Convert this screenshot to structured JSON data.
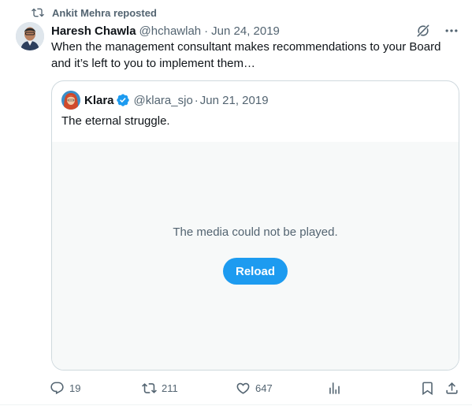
{
  "repost": {
    "text": "Ankit Mehra reposted",
    "icon": "repost-icon"
  },
  "tweet": {
    "author_name": "Haresh Chawla",
    "handle": "@hchawlah",
    "separator": "·",
    "date": "Jun 24, 2019",
    "text": "When the management consultant makes recommendations to your Board and it’s left to you to implement them…"
  },
  "quote": {
    "author_name": "Klara",
    "verified": true,
    "handle": "@klara_sjo",
    "separator": "·",
    "date": "Jun 21, 2019",
    "text": "The eternal struggle.",
    "media_message": "The media could not be played.",
    "reload_label": "Reload"
  },
  "actions": {
    "replies": "19",
    "reposts": "211",
    "likes": "647"
  },
  "colors": {
    "accent": "#1d9bf0",
    "secondary_text": "#536471",
    "border": "#cfd9de",
    "media_bg": "#f7f9f9"
  }
}
